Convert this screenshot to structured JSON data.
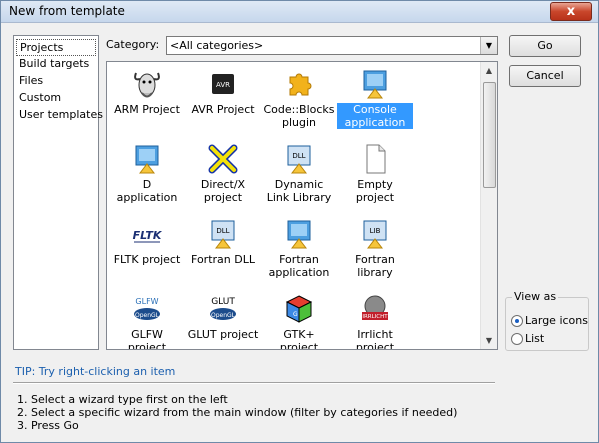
{
  "window": {
    "title": "New from template",
    "close_glyph": "x"
  },
  "left_pane": {
    "items": [
      {
        "label": "Projects",
        "selected": true
      },
      {
        "label": "Build targets"
      },
      {
        "label": "Files"
      },
      {
        "label": "Custom"
      },
      {
        "label": "User templates"
      }
    ]
  },
  "category": {
    "label": "Category:",
    "value": "<All categories>"
  },
  "templates": [
    {
      "label": "ARM Project",
      "icon": "gnu-icon"
    },
    {
      "label": "AVR Project",
      "icon": "avr-chip-icon"
    },
    {
      "label": "Code::Blocks plugin",
      "icon": "puzzle-plugin-icon"
    },
    {
      "label": "Console application",
      "icon": "console-app-icon",
      "selected": true
    },
    {
      "label": "D application",
      "icon": "d-app-icon"
    },
    {
      "label": "Direct/X project",
      "icon": "directx-icon"
    },
    {
      "label": "Dynamic Link Library",
      "icon": "dll-icon"
    },
    {
      "label": "Empty project",
      "icon": "blank-page-icon"
    },
    {
      "label": "FLTK project",
      "icon": "fltk-icon"
    },
    {
      "label": "Fortran DLL",
      "icon": "fortran-dll-icon"
    },
    {
      "label": "Fortran application",
      "icon": "fortran-app-icon"
    },
    {
      "label": "Fortran library",
      "icon": "fortran-lib-icon"
    },
    {
      "label": "GLFW project",
      "icon": "glfw-icon",
      "logo_text": "GLFW"
    },
    {
      "label": "GLUT project",
      "icon": "glut-icon",
      "logo_text": "GLUT"
    },
    {
      "label": "GTK+ project",
      "icon": "gtk-icon"
    },
    {
      "label": "Irrlicht project",
      "icon": "irrlicht-icon"
    }
  ],
  "buttons": {
    "go": "Go",
    "cancel": "Cancel"
  },
  "view_as": {
    "title": "View as",
    "options": [
      {
        "label": "Large icons",
        "checked": true
      },
      {
        "label": "List",
        "checked": false
      }
    ]
  },
  "tip": "TIP: Try right-clicking an item",
  "steps": [
    "1. Select a wizard type first on the left",
    "2. Select a specific wizard from the main window (filter by categories if needed)",
    "3. Press Go"
  ],
  "colors": {
    "selection": "#3399ff",
    "tip_text": "#1b5fae",
    "title_bar": "#c6d7ec"
  }
}
